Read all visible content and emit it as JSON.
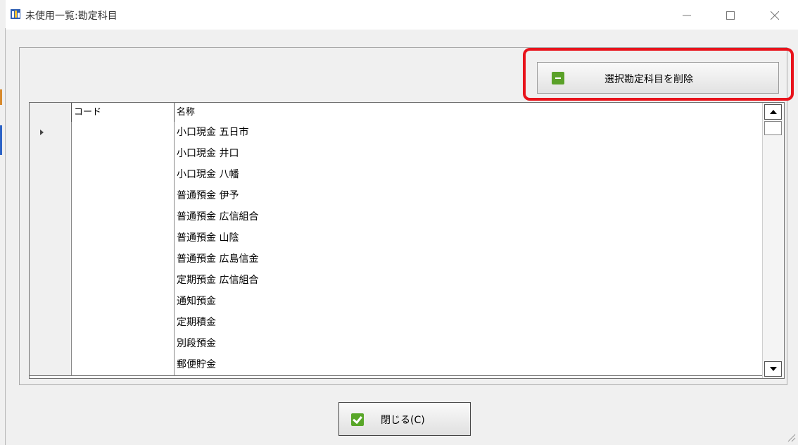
{
  "window": {
    "title": "未使用一覧:勘定科目",
    "minimize_icon": "minimize-icon",
    "maximize_icon": "maximize-icon",
    "close_icon": "close-icon"
  },
  "toolbar": {
    "delete_label": "選択勘定科目を削除",
    "delete_icon": "minus-icon",
    "highlight_color": "#e8131b"
  },
  "grid": {
    "columns": [
      "",
      "コード",
      "名称"
    ],
    "rows": [
      {
        "code": "",
        "name": "小口現金 五日市",
        "current": true
      },
      {
        "code": "",
        "name": "小口現金 井口"
      },
      {
        "code": "",
        "name": "小口現金 八幡"
      },
      {
        "code": "",
        "name": "普通預金 伊予"
      },
      {
        "code": "",
        "name": "普通預金 広信組合"
      },
      {
        "code": "",
        "name": "普通預金 山陰"
      },
      {
        "code": "",
        "name": "普通預金 広島信金"
      },
      {
        "code": "",
        "name": "定期預金 広信組合"
      },
      {
        "code": "",
        "name": "通知預金"
      },
      {
        "code": "",
        "name": "定期積金"
      },
      {
        "code": "",
        "name": "別段預金"
      },
      {
        "code": "",
        "name": "郵便貯金"
      }
    ]
  },
  "footer": {
    "close_label": "閉じる(C)",
    "close_icon": "checkmark-icon"
  },
  "colors": {
    "accent_green": "#5aa128",
    "highlight_red": "#e8131b"
  }
}
